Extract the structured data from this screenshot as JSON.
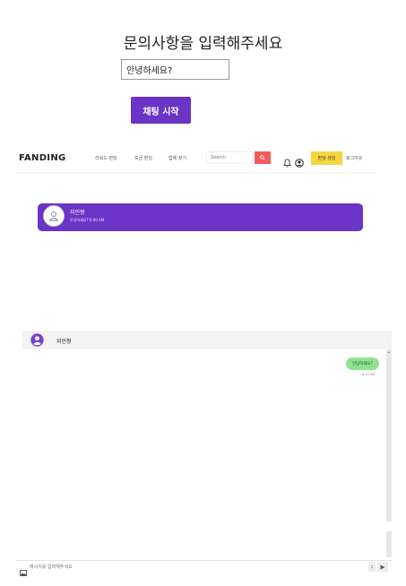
{
  "inquiry": {
    "title": "문의사항을 입력해주세요",
    "input_value": "안녕하세요?",
    "start_button": "채팅 시작"
  },
  "navbar": {
    "logo": "FANDING",
    "links": [
      "리워드 펀딩",
      "모금 펀딩",
      "업체 찾기"
    ],
    "search_placeholder": "Search",
    "search_icon": "search-icon",
    "create_button": "펀딩 생성",
    "logout": "로그아웃"
  },
  "chat_list": {
    "items": [
      {
        "name": "지민짱",
        "preview": "안녕하세요? 6:40 AM"
      }
    ]
  },
  "chat_window": {
    "header_name": "지민짱",
    "messages": [
      {
        "text": "안녕하세요?",
        "time": "6:40 AM",
        "sender": "me"
      }
    ],
    "input_placeholder": "메시지를 입력해주세요",
    "send_icon": "send-icon"
  },
  "colors": {
    "primary": "#6a34c6",
    "search": "#f25a5a",
    "create": "#f6d63f",
    "bubble": "#8fe28f"
  }
}
